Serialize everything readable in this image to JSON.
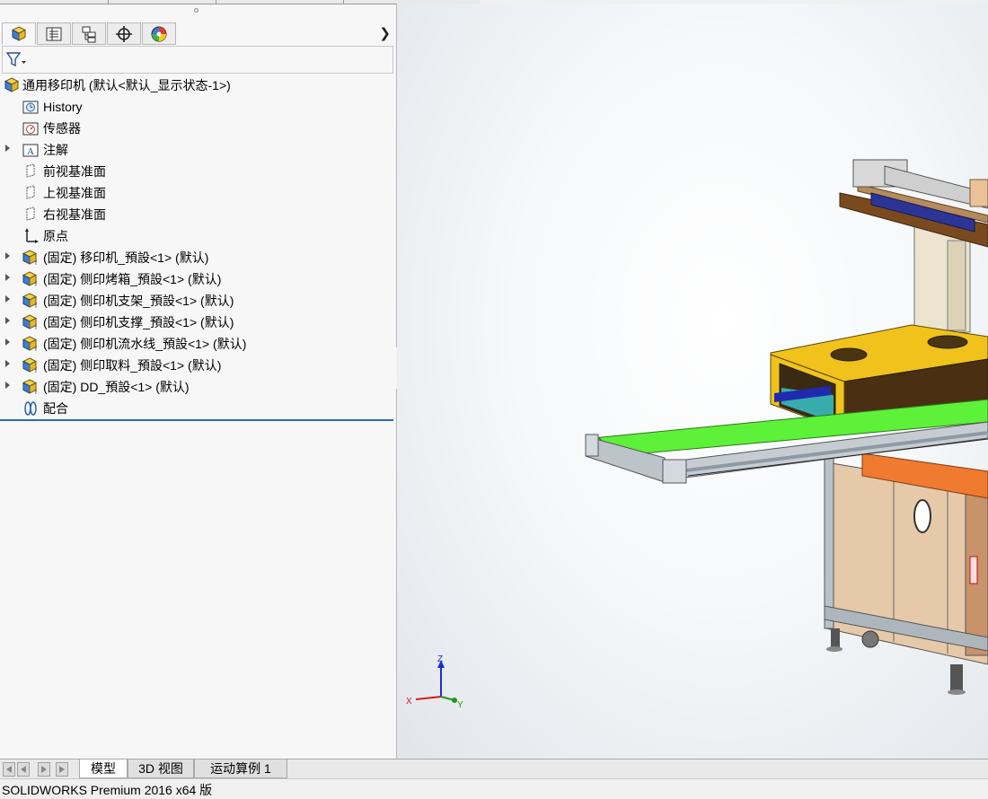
{
  "panel_tabs": [
    {
      "icon": "feature-manager-icon",
      "active": true
    },
    {
      "icon": "property-manager-icon",
      "active": false
    },
    {
      "icon": "configuration-manager-icon",
      "active": false
    },
    {
      "icon": "dimxpert-manager-icon",
      "active": false
    },
    {
      "icon": "display-manager-icon",
      "active": false
    }
  ],
  "tree": {
    "root": {
      "label": "通用移印机  (默认<默认_显示状态-1>)",
      "icon": "assembly-icon"
    },
    "items": [
      {
        "label": "History",
        "icon": "history-folder-icon",
        "expandable": false
      },
      {
        "label": "传感器",
        "icon": "sensors-folder-icon",
        "expandable": false
      },
      {
        "label": "注解",
        "icon": "annotations-folder-icon",
        "expandable": true
      },
      {
        "label": "前视基准面",
        "icon": "plane-icon",
        "expandable": false
      },
      {
        "label": "上视基准面",
        "icon": "plane-icon",
        "expandable": false
      },
      {
        "label": "右视基准面",
        "icon": "plane-icon",
        "expandable": false
      },
      {
        "label": "原点",
        "icon": "origin-icon",
        "expandable": false
      },
      {
        "label": "(固定) 移印机_預設<1> (默认)",
        "icon": "subassembly-icon",
        "expandable": true
      },
      {
        "label": "(固定) 侧印烤箱_預設<1> (默认)",
        "icon": "subassembly-icon",
        "expandable": true
      },
      {
        "label": "(固定) 侧印机支架_預設<1> (默认)",
        "icon": "subassembly-icon",
        "expandable": true
      },
      {
        "label": "(固定) 侧印机支撑_預設<1> (默认)",
        "icon": "subassembly-icon",
        "expandable": true
      },
      {
        "label": "(固定) 侧印机流水线_預設<1> (默认)",
        "icon": "subassembly-icon",
        "expandable": true
      },
      {
        "label": "(固定) 侧印取料_預設<1> (默认)",
        "icon": "subassembly-icon",
        "expandable": true
      },
      {
        "label": "(固定) DD_預設<1> (默认)",
        "icon": "subassembly-icon",
        "expandable": true
      },
      {
        "label": "配合",
        "icon": "mates-icon",
        "expandable": false
      }
    ]
  },
  "triad": {
    "z": "Z",
    "x": "X",
    "y": "Y"
  },
  "bottom_tabs": [
    {
      "label": "模型",
      "active": true
    },
    {
      "label": "3D 视图",
      "active": false
    },
    {
      "label": "运动算例 1",
      "active": false
    }
  ],
  "status": {
    "text": "SOLIDWORKS Premium 2016 x64 版"
  },
  "colors": {
    "accent": "#2a6bb1",
    "conveyor_belt": "#5ef13a",
    "oven_cover": "#f1c21b",
    "cabinet": "#e6c9a8"
  }
}
